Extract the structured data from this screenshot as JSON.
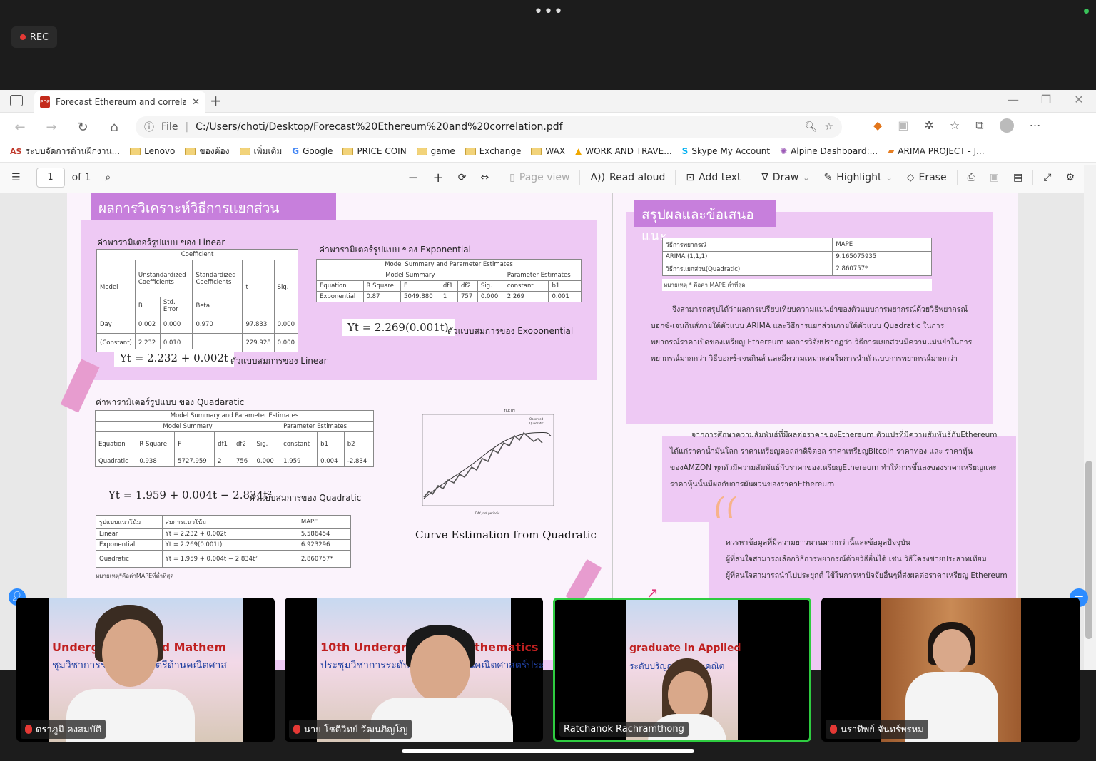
{
  "recording": {
    "label": "REC"
  },
  "browser": {
    "tab_title": "Forecast Ethereum and correlatio",
    "url_scheme": "File",
    "url": "C:/Users/choti/Desktop/Forecast%20Ethereum%20and%20correlation.pdf",
    "bookmarks": [
      "ระบบจัดการด้านฝึกงาน...",
      "Lenovo",
      "ของต้อง",
      "เพิ่มเติม",
      "Google",
      "PRICE COIN",
      "game",
      "Exchange",
      "WAX",
      "WORK AND TRAVE...",
      "Skype My Account",
      "Alpine Dashboard:...",
      "ARIMA PROJECT - J..."
    ],
    "bookmark_prefix": "AS"
  },
  "pdf_toolbar": {
    "page": "1",
    "of": "of 1",
    "page_view": "Page view",
    "read_aloud": "Read aloud",
    "add_text": "Add text",
    "draw": "Draw",
    "highlight": "Highlight",
    "erase": "Erase"
  },
  "poster": {
    "left_heading": "ผลการวิเคราะห์วิธีการแยกส่วน",
    "linear_label": "ค่าพารามิเตอร์รูปแบบ ของ Linear",
    "linear_table": {
      "title": "Coefficient",
      "h1": [
        "Model",
        "Unstandardized Coefficients",
        "Standardized Coefficients",
        "t",
        "Sig."
      ],
      "h2": [
        "B",
        "Std. Error",
        "Beta"
      ],
      "rows": [
        [
          "Day",
          "0.002",
          "0.000",
          "0.970",
          "97.833",
          "0.000"
        ],
        [
          "(Constant)",
          "2.232",
          "0.010",
          "",
          "229.928",
          "0.000"
        ]
      ]
    },
    "linear_eq": "Yt = 2.232 + 0.002t",
    "linear_eq_label": "ตัวแบบสมการของ Linear",
    "exp_label": "ค่าพารามิเตอร์รูปแบบ ของ Exponential",
    "exp_table": {
      "title": "Model Summary and Parameter Estimates",
      "ms": "Model Summary",
      "pe": "Parameter Estimates",
      "cols": [
        "Equation",
        "R Square",
        "F",
        "df1",
        "df2",
        "Sig.",
        "constant",
        "b1"
      ],
      "row": [
        "Exponential",
        "0.87",
        "5049.880",
        "1",
        "757",
        "0.000",
        "2.269",
        "0.001"
      ]
    },
    "exp_eq": "Yt = 2.269(0.001t)",
    "exp_eq_label": "ตัวแบบสมการของ Exoponential",
    "quad_label": "ค่าพารามิเตอร์รูปแบบ ของ Quadaratic",
    "quad_table": {
      "title": "Model Summary and Parameter Estimates",
      "ms": "Model Summary",
      "pe": "Parameter Estimates",
      "cols": [
        "Equation",
        "R Square",
        "F",
        "df1",
        "df2",
        "Sig.",
        "constant",
        "b1",
        "b2"
      ],
      "row": [
        "Quadratic",
        "0.938",
        "5727.959",
        "2",
        "756",
        "0.000",
        "1.959",
        "0.004",
        "-2.834"
      ]
    },
    "quad_eq": "Yt = 1.959 + 0.004t − 2.834t²",
    "quad_eq_label": "ตัวแบบสมการของ Quadratic",
    "mape_table": {
      "cols": [
        "รูปแบบแนวโน้ม",
        "สมการแนวโน้ม",
        "MAPE"
      ],
      "rows": [
        [
          "Linear",
          "Yt = 2.232 + 0.002t",
          "5.586454"
        ],
        [
          "Exponential",
          "Yt = 2.269(0.001t)",
          "6.923296"
        ],
        [
          "Quadratic",
          "Yt = 1.959 + 0.004t − 2.834t²",
          "2.860757*"
        ]
      ]
    },
    "mape_note": "หมายเหตุ*คือค่าMAPEที่ต่ำที่สุด",
    "curve_caption": "Curve Estimation from Quadratic",
    "curve_title": "YLETH",
    "curve_legend": [
      "Observed",
      "Quadratic"
    ],
    "curve_xlabel": "DAY, not periodic",
    "right_heading": "สรุปผลและข้อเสนอแนะ",
    "summary_table": {
      "cols": [
        "วิธีการพยากรณ์",
        "MAPE"
      ],
      "rows": [
        [
          "ARIMA (1,1,1)",
          "9.165075935"
        ],
        [
          "วิธีการแยกส่วน(Quadratic)",
          "2.860757*"
        ]
      ]
    },
    "summary_note": "หมายเหตุ * คือค่า MAPE ต่ำที่สุด",
    "conclusion": [
      "จึงสามารถสรุปได้ว่าผลการเปรียบเทียบความแม่นยำของตัวแบบการพยากรณ์ด้วยวิธีพยากรณ์",
      "บอกซ์-เจนกินส์ภายใต้ตัวแบบ ARIMA และวิธีการแยกส่วนภายใต้ตัวแบบ Quadratic ในการ",
      "พยากรณ์ราคาเปิดของเหรียญ Ethereum ผลการวิจัยปรากฏว่า วิธีการแยกส่วนมีความแม่นยำในการ",
      "พยากรณ์มากกว่า วิธีบอกซ์-เจนกินส์ และมีความเหมาะสมในการนำตัวแบบการพยากรณ์มากกว่า"
    ],
    "correlation": [
      "จากการศึกษาความสัมพันธ์ที่มีผลต่อราคาของEthereum ตัวแปรที่มีความสัมพันธ์กับEthereum",
      "ได้แก่ราคาน้ำมันโลก ราคาเหรียญดอลล่าดิจิตอล ราคาเหรียญBitcoin ราคาทอง และ ราคาหุ้น",
      "ของAMZON ทุกตัวมีความสัมพันธ์กับราคาของเหรียญEthereum ทำให้การขึ้นลงของราคาเหรียญและ",
      "ราคาหุ้นนั้นมีผลกับการผันผวนของราคาEthereum"
    ],
    "suggestion": [
      "ควรหาข้อมูลที่มีความยาวนานมากกว่านี้และข้อมูลปัจจุบัน",
      "ผู้ที่สนใจสามารถเลือกวิธีการพยากรณ์ด้วยวิธีอื่นได้ เช่น วิธีโครงข่ายประสาทเทียม",
      "ผู้ที่สนใจสามารถนำไปประยุกต์ ใช้ในการหาปัจจัยอื่นๆที่ส่งผลต่อราคาเหรียญ Ethereum"
    ]
  },
  "participants": [
    {
      "name": "ดราภูมิ คงสมบัติ",
      "banner": "Undergr   n Applied Mathem",
      "banner2": "ชุมวิชาการระ   นุปริญญาตรีด้านคณิตศาส",
      "muted": true
    },
    {
      "name": "นาย โชติวิทย์ วัฒนภิญโญ",
      "banner": "10th Undergraduate      Mathematics",
      "banner2": "ประชุมวิชาการระดับปริญญาตรีด้านคณิตศาสตร์ประยุ",
      "muted": true
    },
    {
      "name": "Ratchanok Rachramthong",
      "banner": "graduate in Applied",
      "banner2": "ระดับปริญญาตรีด้านคณิต",
      "muted": false
    },
    {
      "name": "นราทิพย์ จันทร์พรหม",
      "banner": "",
      "banner2": "",
      "muted": true
    }
  ],
  "colors": {
    "accent_purple": "#c77fdc",
    "light_purple": "#eec9f4",
    "active_speaker": "#2ecc40"
  }
}
